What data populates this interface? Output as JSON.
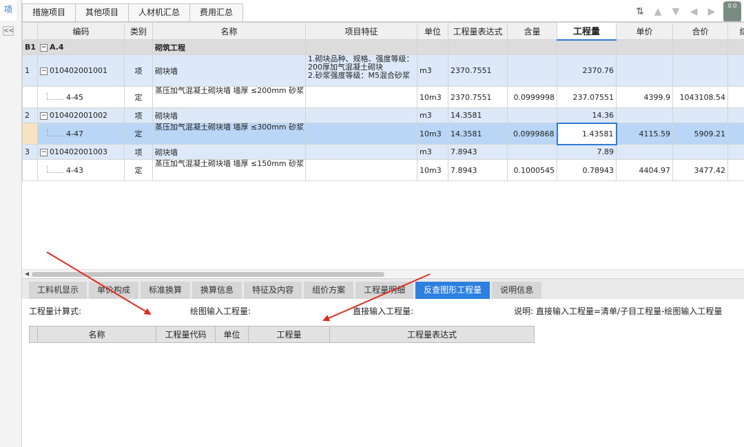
{
  "left_strip": {
    "tab_label": "项",
    "collapse": "<<"
  },
  "top_tabs": [
    "措施项目",
    "其他项目",
    "人材机汇总",
    "费用汇总"
  ],
  "toolbar_badge": "0.0",
  "columns": [
    "",
    "编码",
    "类别",
    "名称",
    "项目特征",
    "单位",
    "工程量表达式",
    "含量",
    "工程量",
    "单价",
    "合价",
    "综"
  ],
  "section": {
    "no": "B1",
    "code": "A.4",
    "name": "砌筑工程"
  },
  "rows": [
    {
      "kind": "qing",
      "no": "1",
      "code": "010402001001",
      "type": "项",
      "name": "砌块墙",
      "feature": "1.砌块品种、规格、强度等级：200厚加气混凝土砌块\n2.砂浆强度等级：M5混合砂浆",
      "unit": "m3",
      "expr": "2370.7551",
      "content": "",
      "qty": "2370.76",
      "price": "",
      "total": ""
    },
    {
      "kind": "ding",
      "no": "",
      "code": "4-45",
      "type": "定",
      "name": "蒸压加气混凝土砌块墙 墙厚 ≤200mm 砂浆",
      "feature": "",
      "unit": "10m3",
      "expr": "2370.7551",
      "content": "0.0999998",
      "qty": "237.07551",
      "price": "4399.9",
      "total": "1043108.54"
    },
    {
      "kind": "qing",
      "no": "2",
      "code": "010402001002",
      "type": "项",
      "name": "砌块墙",
      "feature": "",
      "unit": "m3",
      "expr": "14.3581",
      "content": "",
      "qty": "14.36",
      "price": "",
      "total": ""
    },
    {
      "kind": "sel",
      "no": "",
      "code": "4-47",
      "type": "定",
      "name": "蒸压加气混凝土砌块墙 墙厚 ≤300mm 砂浆",
      "feature": "",
      "unit": "10m3",
      "expr": "14.3581",
      "content": "0.0999868",
      "qty": "1.43581",
      "price": "4115.59",
      "total": "5909.21"
    },
    {
      "kind": "qing",
      "no": "3",
      "code": "010402001003",
      "type": "项",
      "name": "砌块墙",
      "feature": "",
      "unit": "m3",
      "expr": "7.8943",
      "content": "",
      "qty": "7.89",
      "price": "",
      "total": ""
    },
    {
      "kind": "ding",
      "no": "",
      "code": "4-43",
      "type": "定",
      "name": "蒸压加气混凝土砌块墙 墙厚 ≤150mm 砂浆",
      "feature": "",
      "unit": "10m3",
      "expr": "7.8943",
      "content": "0.1000545",
      "qty": "0.78943",
      "price": "4404.97",
      "total": "3477.42"
    }
  ],
  "bottom_tabs": [
    "工料机显示",
    "单价构成",
    "标准换算",
    "换算信息",
    "特征及内容",
    "组价方案",
    "工程量明细",
    "反查图形工程量",
    "说明信息"
  ],
  "active_bottom_tab": "反查图形工程量",
  "info": {
    "calc_label": "工程量计算式:",
    "drawing_label": "绘图输入工程量:",
    "direct_label": "直接输入工程量:",
    "note": "说明: 直接输入工程量=清单/子目工程量-绘图输入工程量"
  },
  "sub_columns": [
    "",
    "名称",
    "工程量代码",
    "单位",
    "工程量",
    "工程量表达式"
  ],
  "colors": {
    "accent": "#2d7fe0",
    "arrow": "#e02a1f"
  }
}
